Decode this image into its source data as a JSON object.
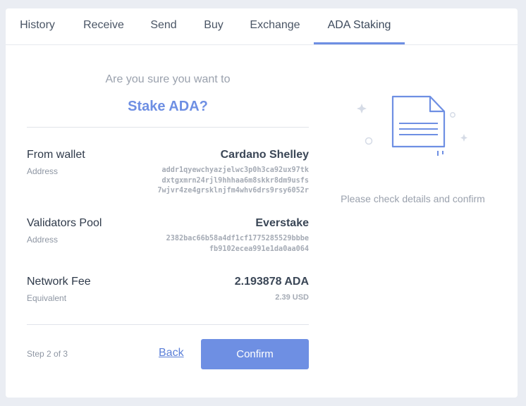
{
  "tabs": [
    {
      "label": "History"
    },
    {
      "label": "Receive"
    },
    {
      "label": "Send"
    },
    {
      "label": "Buy"
    },
    {
      "label": "Exchange"
    },
    {
      "label": "ADA Staking"
    }
  ],
  "active_tab": "ADA Staking",
  "confirm": {
    "title_pre": "Are you sure you want to",
    "title_main": "Stake ADA?"
  },
  "from_wallet": {
    "label": "From wallet",
    "value": "Cardano Shelley",
    "sub_label": "Address",
    "address_lines": [
      "addr1qyewchyazjelwc3p0h3ca92ux97tk",
      "dxtgxmrn24rjl9hhhaa6m8skkr8dm9usfs",
      "7wjvr4ze4grsklnjfm4whv6drs9rsy6052r"
    ]
  },
  "validators_pool": {
    "label": "Validators Pool",
    "value": "Everstake",
    "sub_label": "Address",
    "address_lines": [
      "2382bac66b58a4df1cf1775285529bbbe",
      "fb9102ecea991e1da0aa064"
    ]
  },
  "network_fee": {
    "label": "Network Fee",
    "value": "2.193878 ADA",
    "sub_label": "Equivalent",
    "equivalent": "2.39 USD"
  },
  "footer": {
    "step": "Step 2 of 3",
    "back": "Back",
    "confirm": "Confirm"
  },
  "side": {
    "illustration_icon": "document-icon",
    "hint": "Please check details and confirm"
  },
  "colors": {
    "accent": "#6e8fe3",
    "link": "#5b7fd8",
    "background": "#eaedf3"
  }
}
